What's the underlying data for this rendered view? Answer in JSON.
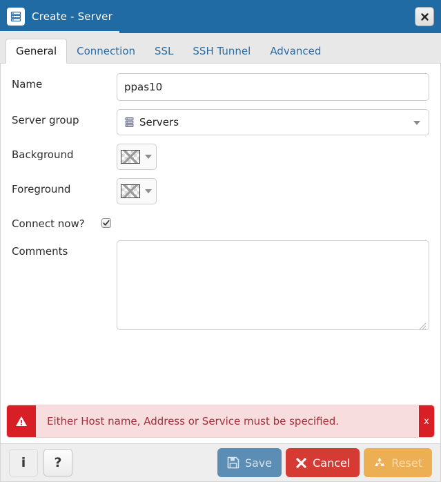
{
  "window": {
    "title": "Create - Server",
    "title_icon": "server-rack-icon",
    "close_label": "✕",
    "accent_color": "#206ba4"
  },
  "tabs": [
    {
      "label": "General",
      "active": true
    },
    {
      "label": "Connection",
      "active": false
    },
    {
      "label": "SSL",
      "active": false
    },
    {
      "label": "SSH Tunnel",
      "active": false
    },
    {
      "label": "Advanced",
      "active": false
    }
  ],
  "form": {
    "name": {
      "label": "Name",
      "value": "ppas10",
      "placeholder": ""
    },
    "server_group": {
      "label": "Server group",
      "value": "Servers",
      "icon": "server-group-icon"
    },
    "background": {
      "label": "Background",
      "swatch": "transparent",
      "icon": "color-swatch-none-icon"
    },
    "foreground": {
      "label": "Foreground",
      "swatch": "transparent",
      "icon": "color-swatch-none-icon"
    },
    "connect_now": {
      "label": "Connect now?",
      "checked": true
    },
    "comments": {
      "label": "Comments",
      "value": "",
      "placeholder": ""
    }
  },
  "alert": {
    "icon": "warning-triangle-icon",
    "message": "Either Host name, Address or Service must be specified.",
    "close_label": "x",
    "bar_color": "#d81f26",
    "body_color": "#f7dddd",
    "text_color": "#a4303a"
  },
  "footer": {
    "info_label": "i",
    "help_label": "?",
    "buttons": [
      {
        "label": "Save",
        "icon": "floppy-disk-icon",
        "color": "#5b8db5"
      },
      {
        "label": "Cancel",
        "icon": "x-mark-icon",
        "color": "#d53a33"
      },
      {
        "label": "Reset",
        "icon": "recycle-icon",
        "color": "#edaf54"
      }
    ]
  }
}
